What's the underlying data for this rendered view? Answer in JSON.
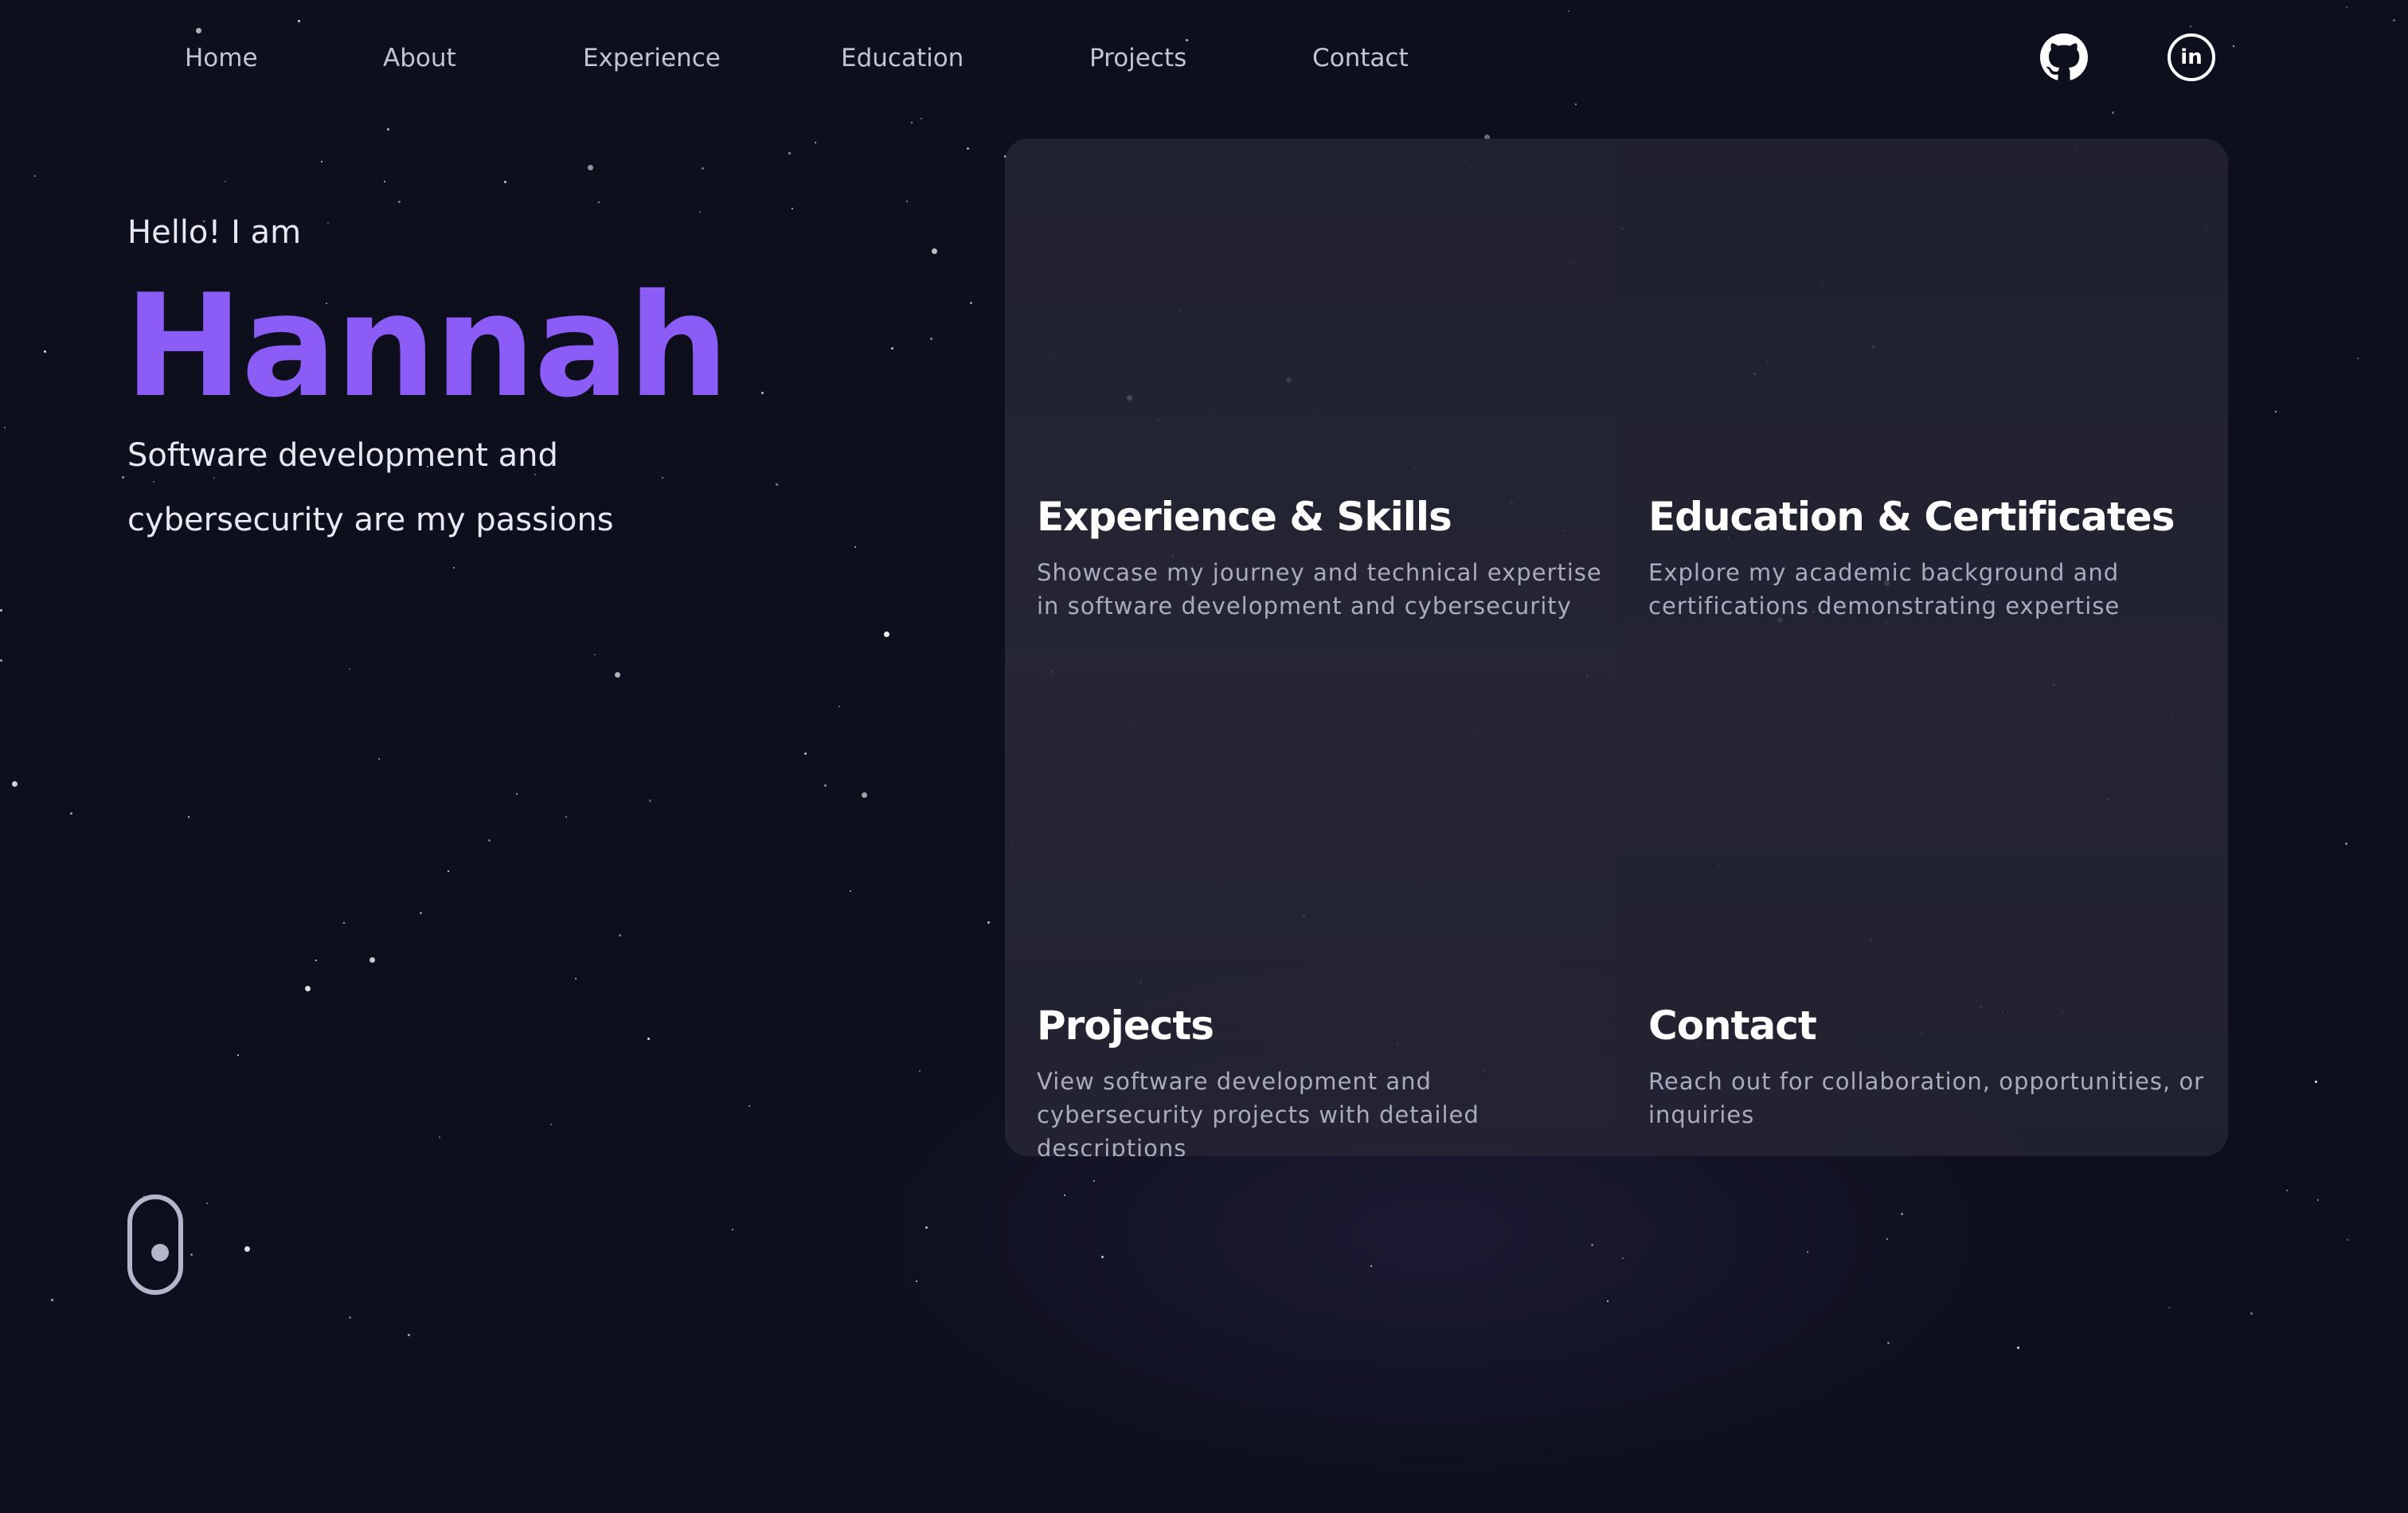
{
  "nav": {
    "links": [
      "Home",
      "About",
      "Experience",
      "Education",
      "Projects",
      "Contact"
    ],
    "icons": [
      "github-icon",
      "linkedin-icon"
    ],
    "linkedin_label": "in"
  },
  "hero": {
    "greeting": "Hello! I am",
    "name": "Hannah",
    "tagline_line1": "Software development and",
    "tagline_line2": "cybersecurity are my passions"
  },
  "cards": [
    {
      "title": "Experience & Skills",
      "description": "Showcase my journey and technical expertise in software development and cybersecurity"
    },
    {
      "title": "Education & Certificates",
      "description": "Explore my academic background and certifications demonstrating expertise"
    },
    {
      "title": "Projects",
      "description": "View software development and cybersecurity projects with detailed descriptions"
    },
    {
      "title": "Contact",
      "description": "Reach out for collaboration, opportunities, or inquiries"
    }
  ],
  "scroll_indicator": "mouse-scroll-icon",
  "colors": {
    "background": "#0d0f1c",
    "accent": "#8b5cf6",
    "text": "#e7e8f2",
    "nav_text": "#c2c4d4",
    "muted": "#a9abbf"
  }
}
